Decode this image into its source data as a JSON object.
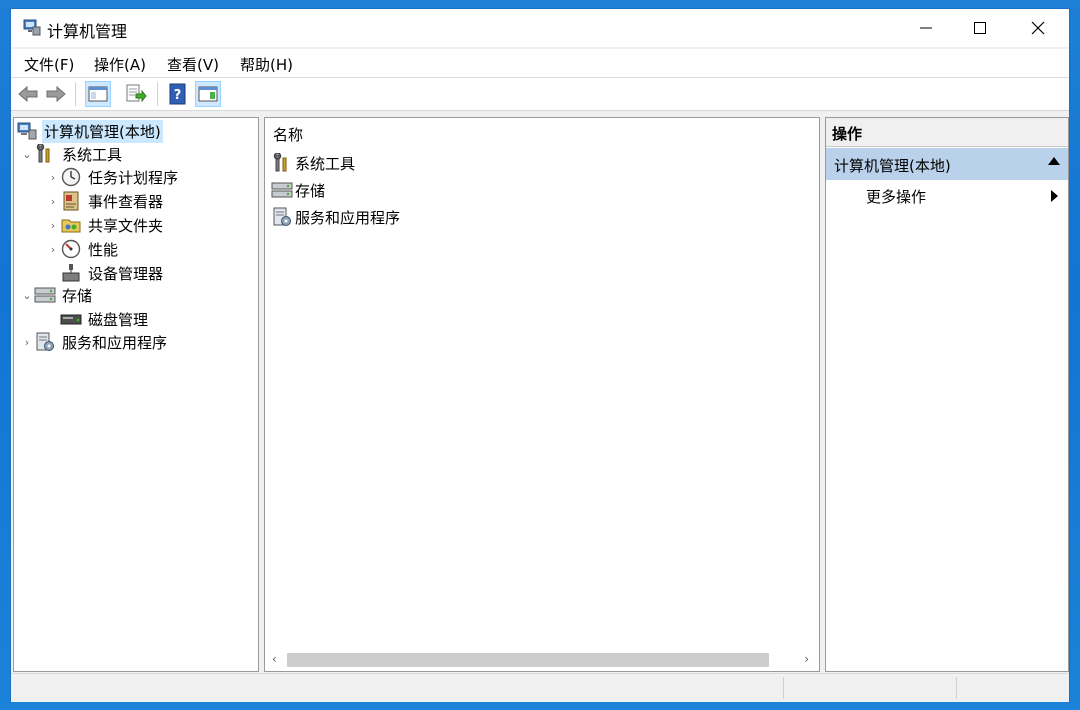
{
  "window": {
    "title": "计算机管理",
    "controls": {
      "minimize": "—",
      "maximize": "☐",
      "close": "✕"
    }
  },
  "menu": [
    {
      "label": "文件(F)"
    },
    {
      "label": "操作(A)"
    },
    {
      "label": "查看(V)"
    },
    {
      "label": "帮助(H)"
    }
  ],
  "toolbar": {
    "buttons": [
      {
        "icon": "back-arrow-icon"
      },
      {
        "icon": "forward-arrow-icon"
      },
      {
        "icon": "show-hide-console-tree-icon"
      },
      {
        "icon": "export-list-icon"
      },
      {
        "icon": "help-icon"
      },
      {
        "icon": "show-hide-action-pane-icon"
      }
    ]
  },
  "tree": {
    "items": [
      {
        "label": "计算机管理(本地)",
        "icon": "computer-management-icon"
      },
      {
        "label": "系统工具",
        "icon": "system-tools-icon"
      },
      {
        "label": "任务计划程序",
        "icon": "task-scheduler-icon"
      },
      {
        "label": "事件查看器",
        "icon": "event-viewer-icon"
      },
      {
        "label": "共享文件夹",
        "icon": "shared-folders-icon"
      },
      {
        "label": "性能",
        "icon": "performance-icon"
      },
      {
        "label": "设备管理器",
        "icon": "device-manager-icon"
      },
      {
        "label": "存储",
        "icon": "storage-icon"
      },
      {
        "label": "磁盘管理",
        "icon": "disk-management-icon"
      },
      {
        "label": "服务和应用程序",
        "icon": "services-applications-icon"
      }
    ]
  },
  "center": {
    "column_header": "名称",
    "rows": [
      {
        "label": "系统工具",
        "icon": "system-tools-icon"
      },
      {
        "label": "存储",
        "icon": "storage-icon"
      },
      {
        "label": "服务和应用程序",
        "icon": "services-applications-icon"
      }
    ],
    "scroll": {
      "left": "‹",
      "right": "›"
    }
  },
  "actions": {
    "header": "操作",
    "section_title": "计算机管理(本地)",
    "items": [
      {
        "label": "更多操作"
      }
    ]
  }
}
